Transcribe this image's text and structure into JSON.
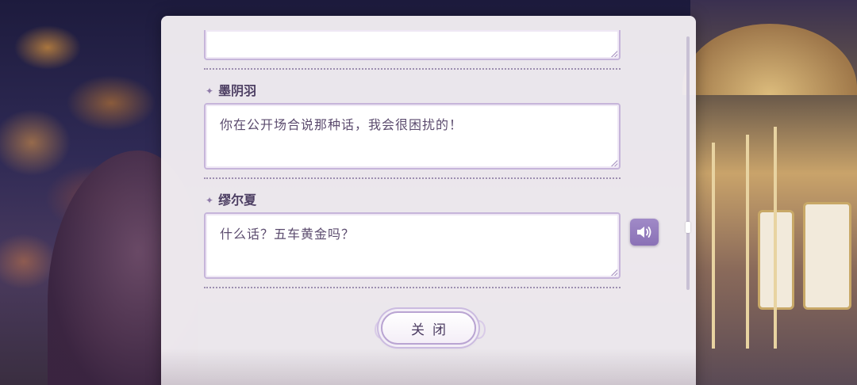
{
  "dialog_log": {
    "entries": [
      {
        "speaker": "",
        "text": ""
      },
      {
        "speaker": "墨阴羽",
        "text": "你在公开场合说那种话，我会很困扰的！"
      },
      {
        "speaker": "缪尔夏",
        "text": "什么话？五车黄金吗？"
      }
    ],
    "close_label": "关闭"
  },
  "icons": {
    "speaker_marker": "sparkle-icon",
    "voice_button": "speaker-volume-icon"
  },
  "colors": {
    "panel": "#f3eef3",
    "accent": "#8a71b6",
    "text": "#5b4b6e"
  }
}
